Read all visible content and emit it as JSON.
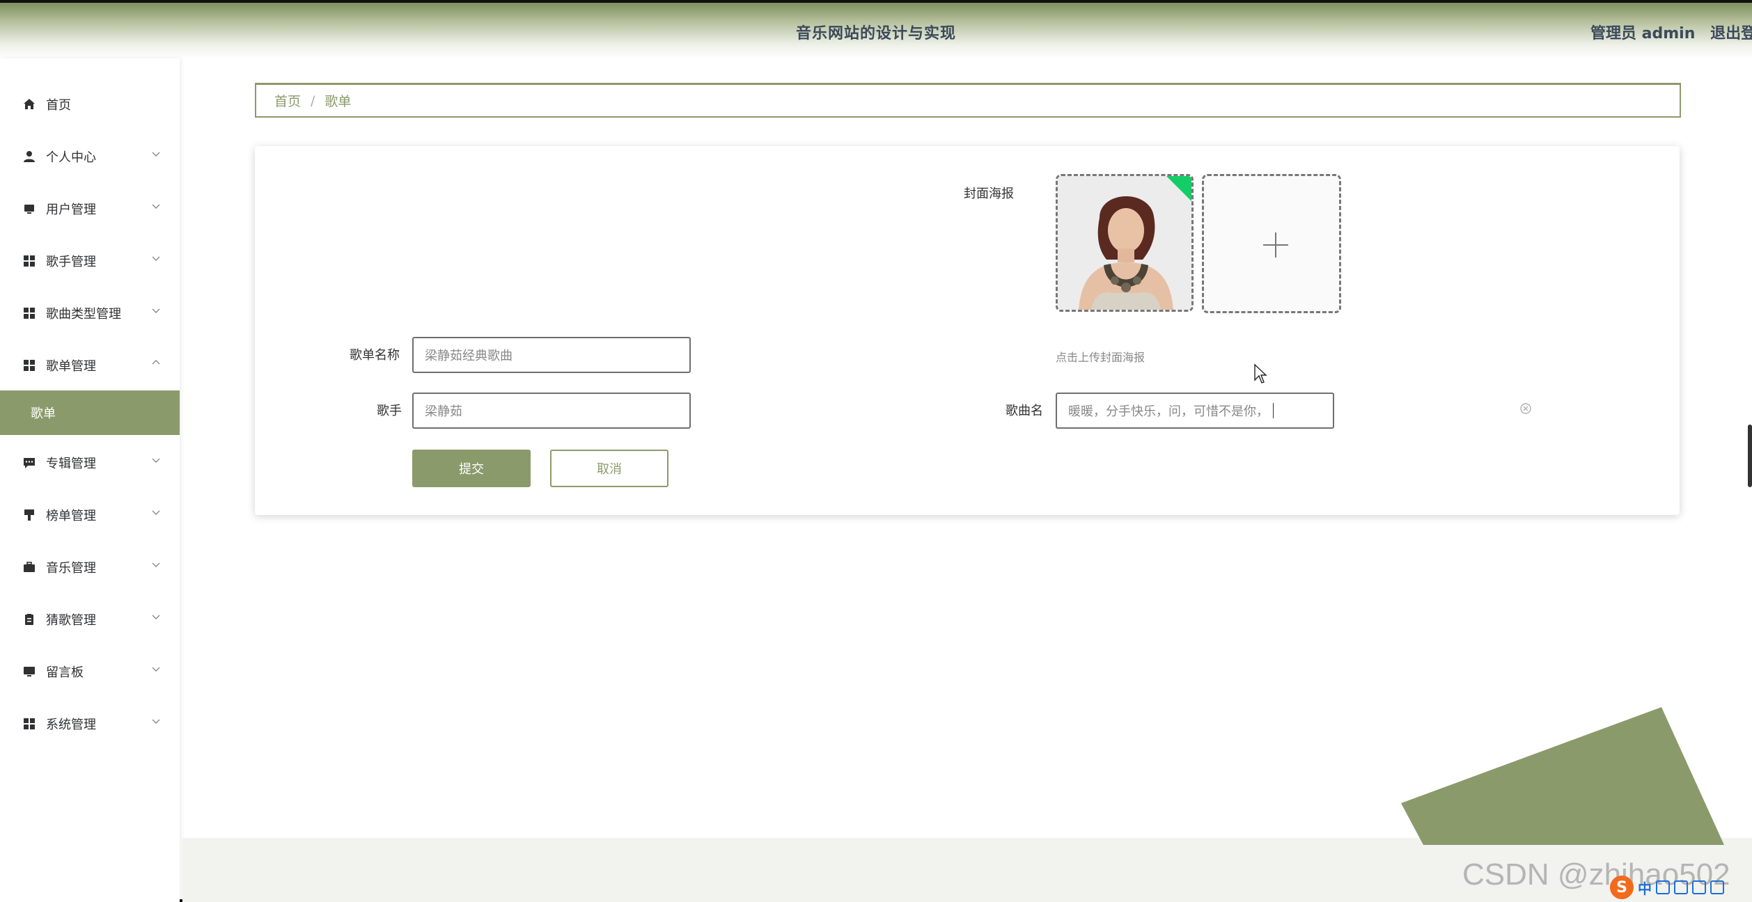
{
  "header": {
    "title": "音乐网站的设计与实现",
    "user_label": "管理员 admin",
    "logout_label": "退出登录"
  },
  "sidebar": {
    "items": [
      {
        "label": "首页",
        "icon": "home-icon",
        "has_children": false
      },
      {
        "label": "个人中心",
        "icon": "user-icon",
        "has_children": true
      },
      {
        "label": "用户管理",
        "icon": "monitor-icon",
        "has_children": true
      },
      {
        "label": "歌手管理",
        "icon": "grid-icon",
        "has_children": true
      },
      {
        "label": "歌曲类型管理",
        "icon": "grid-icon",
        "has_children": true
      },
      {
        "label": "歌单管理",
        "icon": "grid-icon",
        "has_children": true,
        "expanded": true
      },
      {
        "label": "专辑管理",
        "icon": "chat-icon",
        "has_children": true
      },
      {
        "label": "榜单管理",
        "icon": "brush-icon",
        "has_children": true
      },
      {
        "label": "音乐管理",
        "icon": "briefcase-icon",
        "has_children": true
      },
      {
        "label": "猜歌管理",
        "icon": "clipboard-icon",
        "has_children": true
      },
      {
        "label": "留言板",
        "icon": "monitor-icon",
        "has_children": true
      },
      {
        "label": "系统管理",
        "icon": "grid-icon",
        "has_children": true
      }
    ],
    "active_sub": "歌单"
  },
  "breadcrumb": {
    "home": "首页",
    "separator": "/",
    "current": "歌单"
  },
  "form": {
    "playlist_name_label": "歌单名称",
    "playlist_name_value": "梁静茹经典歌曲",
    "singer_label": "歌手",
    "singer_value": "梁静茹",
    "poster_label": "封面海报",
    "poster_hint": "点击上传封面海报",
    "song_name_label": "歌曲名",
    "song_name_value": "暖暖，分手快乐，问，可惜不是你，",
    "submit_label": "提交",
    "cancel_label": "取消"
  },
  "watermark": "CSDN @zhihao502",
  "ime": {
    "text": "中"
  },
  "colors": {
    "accent": "#8b9a6b",
    "upload_success": "#13ce66",
    "text": "#303133"
  }
}
